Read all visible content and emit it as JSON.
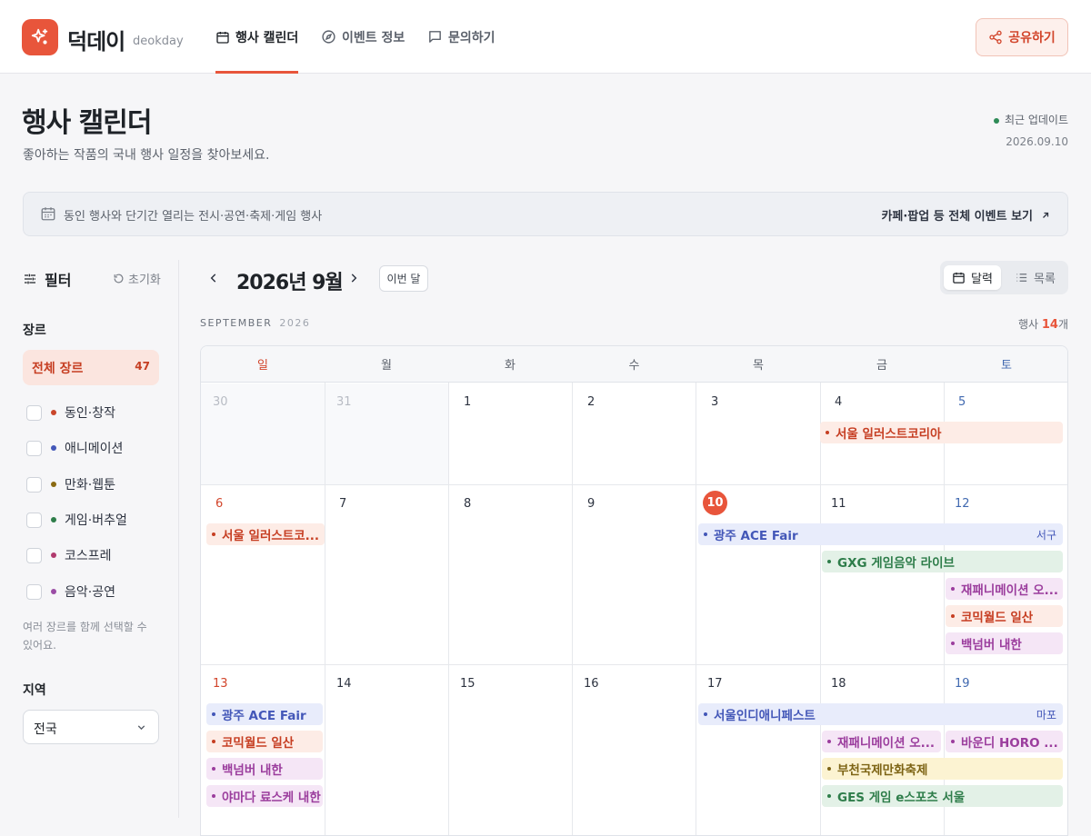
{
  "app": {
    "brand": "덕데이",
    "brand_sub": "deokday",
    "nav": [
      {
        "label": "행사 캘린더",
        "icon": "calendar-icon",
        "active": true
      },
      {
        "label": "이벤트 정보",
        "icon": "compass-icon",
        "active": false
      },
      {
        "label": "문의하기",
        "icon": "chat-icon",
        "active": false
      }
    ],
    "share_label": "공유하기"
  },
  "header": {
    "title": "행사 캘린더",
    "subtitle": "좋아하는 작품의 국내 행사 일정을 찾아보세요.",
    "update_label": "최근 업데이트",
    "update_date": "2026.09.10"
  },
  "banner": {
    "text": "동인 행사와 단기간 열리는 전시·공연·축제·게임 행사",
    "link": "카페·팝업 등 전체 이벤트 보기"
  },
  "filter": {
    "title": "필터",
    "reset": "초기화",
    "genre_label": "장르",
    "genre_all": {
      "label": "전체 장르",
      "count": "47"
    },
    "genres": [
      {
        "label": "동인·창작",
        "color": "#c9462b"
      },
      {
        "label": "애니메이션",
        "color": "#4357b8"
      },
      {
        "label": "만화·웹툰",
        "color": "#8a6a12"
      },
      {
        "label": "게임·버추얼",
        "color": "#2e7d4a"
      },
      {
        "label": "코스프레",
        "color": "#b03a6e"
      },
      {
        "label": "음악·공연",
        "color": "#9b4da5"
      }
    ],
    "genre_hint": "여러 장르를 함께 선택할 수 있어요.",
    "region_label": "지역",
    "region_value": "전국"
  },
  "calendar": {
    "title": "2026년 9월",
    "this_month": "이번 달",
    "views": {
      "calendar": "달력",
      "list": "목록",
      "active": "calendar"
    },
    "caption_month": "SEPTEMBER",
    "caption_year": "2026",
    "count_prefix": "행사 ",
    "count": "14",
    "count_suffix": "개",
    "weekdays": [
      "일",
      "월",
      "화",
      "수",
      "목",
      "금",
      "토"
    ],
    "weeks": [
      [
        "30",
        "31",
        "1",
        "2",
        "3",
        "4",
        "5"
      ],
      [
        "6",
        "7",
        "8",
        "9",
        "10",
        "11",
        "12"
      ],
      [
        "13",
        "14",
        "15",
        "16",
        "17",
        "18",
        "19"
      ]
    ],
    "today": "10",
    "events": [
      {
        "title": "서울 일러스트코리아",
        "color": "orange"
      },
      {
        "title": "서울 일러스트코...",
        "color": "orange"
      },
      {
        "title": "광주 ACE Fair",
        "tag": "서구",
        "color": "blue"
      },
      {
        "title": "GXG 게임음악 라이브",
        "color": "green"
      },
      {
        "title": "재패니메이션 오...",
        "color": "purple"
      },
      {
        "title": "코믹월드 일산",
        "color": "orange"
      },
      {
        "title": "백넘버 내한",
        "color": "purple"
      },
      {
        "title": "광주 ACE Fair",
        "color": "blue"
      },
      {
        "title": "코믹월드 일산",
        "color": "orange"
      },
      {
        "title": "백넘버 내한",
        "color": "purple"
      },
      {
        "title": "야마다 료스케 내한",
        "color": "purple"
      },
      {
        "title": "서울인디애니페스트",
        "tag": "마포",
        "color": "blue"
      },
      {
        "title": "재패니메이션 오...",
        "color": "purple"
      },
      {
        "title": "바운디 HORO ...",
        "color": "purple"
      },
      {
        "title": "부천국제만화축제",
        "color": "yellow"
      },
      {
        "title": "GES 게임 e스포츠 서울",
        "color": "green"
      }
    ]
  }
}
